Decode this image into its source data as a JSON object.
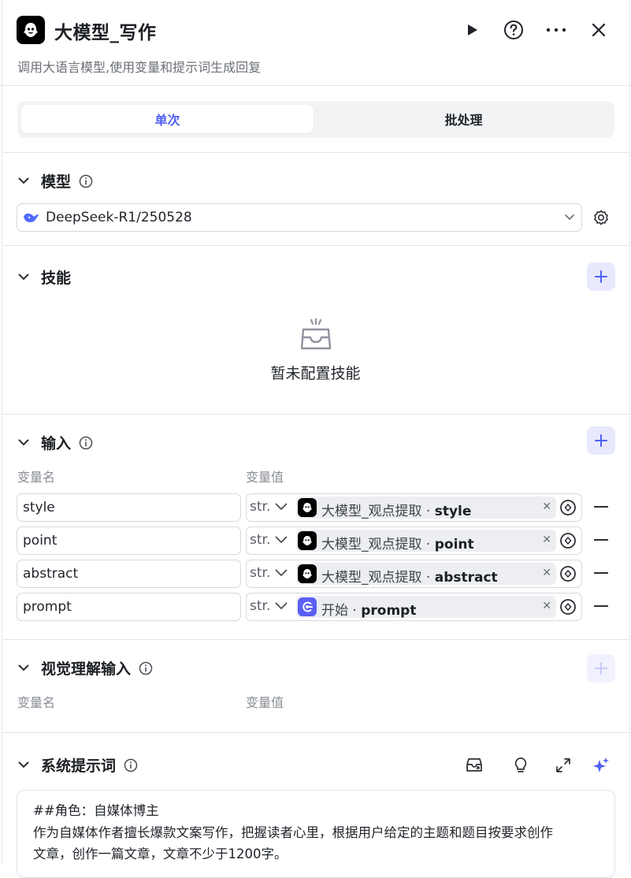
{
  "header": {
    "title": "大模型_写作",
    "subtitle": "调用大语言模型,使用变量和提示词生成回复",
    "icons": [
      "run-icon",
      "help-icon",
      "more-icon",
      "close-icon"
    ]
  },
  "tabs": {
    "single": "单次",
    "batch": "批处理",
    "active": "single"
  },
  "model_section": {
    "title": "模型",
    "model_name": "DeepSeek-R1/250528"
  },
  "skills_section": {
    "title": "技能",
    "empty_text": "暂未配置技能"
  },
  "input_section": {
    "title": "输入",
    "col_name": "变量名",
    "col_value": "变量值",
    "rows": [
      {
        "name": "style",
        "type": "str.",
        "source": "大模型_观点提取",
        "sep": " · ",
        "field": "style",
        "source_icon": "llm-node-icon"
      },
      {
        "name": "point",
        "type": "str.",
        "source": "大模型_观点提取",
        "sep": " · ",
        "field": "point",
        "source_icon": "llm-node-icon"
      },
      {
        "name": "abstract",
        "type": "str.",
        "source": "大模型_观点提取",
        "sep": " · ",
        "field": "abstract",
        "source_icon": "llm-node-icon"
      },
      {
        "name": "prompt",
        "type": "str.",
        "source": "开始",
        "sep": " · ",
        "field": "prompt",
        "source_icon": "start-node-icon"
      }
    ]
  },
  "vision_section": {
    "title": "视觉理解输入",
    "col_name": "变量名",
    "col_value": "变量值"
  },
  "system_prompt": {
    "title": "系统提示词",
    "tool_icons": [
      "library-icon",
      "idea-icon",
      "expand-icon",
      "ai-sparkle-icon"
    ],
    "lines": [
      "##角色：自媒体博主",
      "作为自媒体作者擅长爆款文案写作，把握读者心里，根据用户给定的主题和题目按要求创作",
      "文章，创作一篇文章，文章不少于1200字。"
    ]
  },
  "colors": {
    "accent": "#4e5ff5",
    "accent_bg": "#e8e9fc",
    "border": "#d6d8de"
  }
}
